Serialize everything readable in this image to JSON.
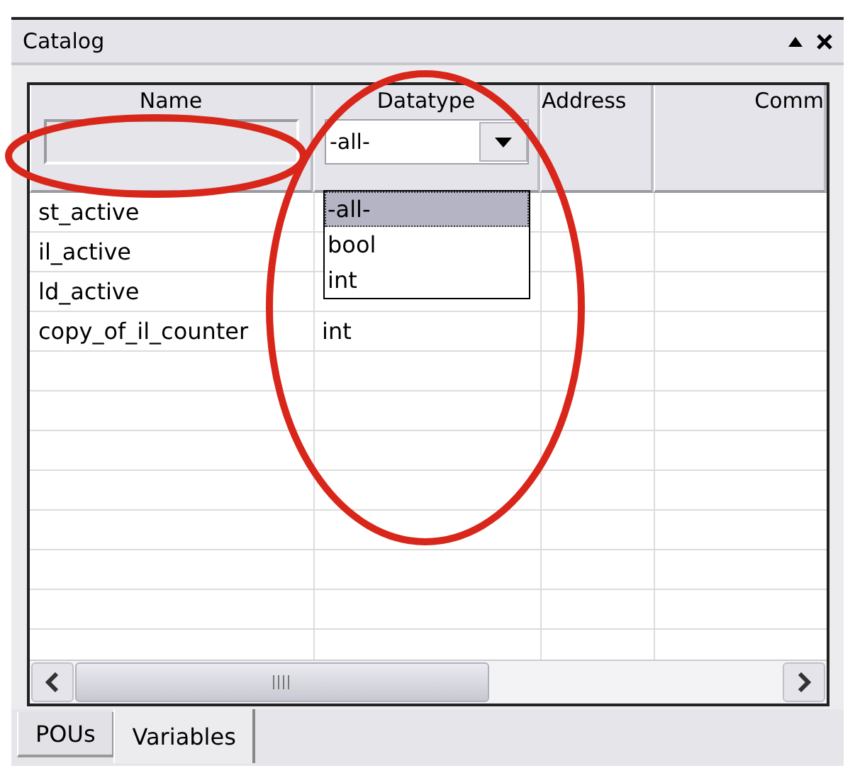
{
  "window": {
    "title": "Catalog"
  },
  "table": {
    "columns": [
      {
        "label": "Name",
        "filter": {
          "kind": "text"
        }
      },
      {
        "label": "Datatype",
        "filter": {
          "kind": "combo",
          "value": "-all-",
          "open": true,
          "options": [
            {
              "label": "-all-",
              "selected": true
            },
            {
              "label": "bool",
              "selected": false
            },
            {
              "label": "int",
              "selected": false
            }
          ]
        }
      },
      {
        "label": "Address"
      },
      {
        "label": "Comm"
      }
    ],
    "rows": [
      {
        "cells": [
          "st_active"
        ]
      },
      {
        "cells": [
          "il_active"
        ]
      },
      {
        "cells": [
          "ld_active"
        ]
      },
      {
        "cells": [
          "copy_of_il_counter",
          "int"
        ]
      }
    ]
  },
  "tabs": [
    {
      "label": "POUs",
      "selected": false
    },
    {
      "label": "Variables",
      "selected": true
    }
  ],
  "annotations": [
    {
      "kind": "ellipse"
    },
    {
      "kind": "ellipse"
    }
  ]
}
